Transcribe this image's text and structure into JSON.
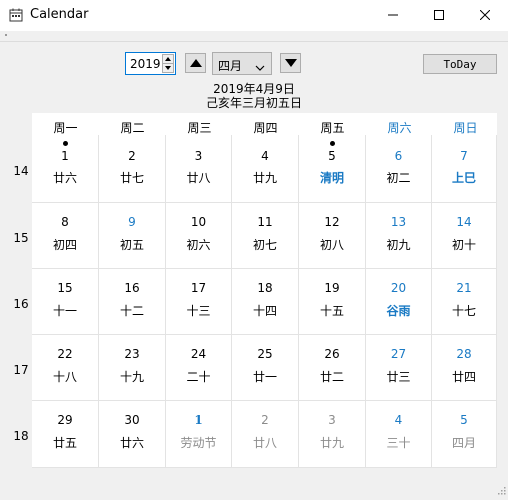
{
  "window": {
    "title": "Calendar"
  },
  "toolbar": {
    "year_value": "2019",
    "month_value": "四月",
    "today_label": "ToDay"
  },
  "date_info": {
    "solar": "2019年4月9日",
    "lunar": "己亥年三月初五日"
  },
  "weekdays": [
    "周一",
    "周二",
    "周三",
    "周四",
    "周五",
    "周六",
    "周日"
  ],
  "week_numbers": [
    "14",
    "15",
    "16",
    "17",
    "18"
  ],
  "weeks": [
    [
      {
        "day": "1",
        "lunar": "廿六",
        "dot": true
      },
      {
        "day": "2",
        "lunar": "廿七"
      },
      {
        "day": "3",
        "lunar": "廿八"
      },
      {
        "day": "4",
        "lunar": "廿九"
      },
      {
        "day": "5",
        "lunar": "清明",
        "dot": true,
        "festival": true
      },
      {
        "day": "6",
        "lunar": "初二",
        "weekend": true
      },
      {
        "day": "7",
        "lunar": "上巳",
        "weekend": true,
        "festival": true
      }
    ],
    [
      {
        "day": "8",
        "lunar": "初四"
      },
      {
        "day": "9",
        "lunar": "初五",
        "weekend": true
      },
      {
        "day": "10",
        "lunar": "初六"
      },
      {
        "day": "11",
        "lunar": "初七"
      },
      {
        "day": "12",
        "lunar": "初八"
      },
      {
        "day": "13",
        "lunar": "初九",
        "weekend": true
      },
      {
        "day": "14",
        "lunar": "初十",
        "weekend": true
      }
    ],
    [
      {
        "day": "15",
        "lunar": "十一"
      },
      {
        "day": "16",
        "lunar": "十二"
      },
      {
        "day": "17",
        "lunar": "十三"
      },
      {
        "day": "18",
        "lunar": "十四"
      },
      {
        "day": "19",
        "lunar": "十五"
      },
      {
        "day": "20",
        "lunar": "谷雨",
        "weekend": true,
        "festival": true
      },
      {
        "day": "21",
        "lunar": "十七",
        "weekend": true
      }
    ],
    [
      {
        "day": "22",
        "lunar": "十八"
      },
      {
        "day": "23",
        "lunar": "十九"
      },
      {
        "day": "24",
        "lunar": "二十"
      },
      {
        "day": "25",
        "lunar": "廿一"
      },
      {
        "day": "26",
        "lunar": "廿二"
      },
      {
        "day": "27",
        "lunar": "廿三",
        "weekend": true
      },
      {
        "day": "28",
        "lunar": "廿四",
        "weekend": true
      }
    ],
    [
      {
        "day": "29",
        "lunar": "廿五"
      },
      {
        "day": "30",
        "lunar": "廿六"
      },
      {
        "day": "1",
        "lunar": "劳动节",
        "other_month": true,
        "labor": true
      },
      {
        "day": "2",
        "lunar": "廿八",
        "other_month": true
      },
      {
        "day": "3",
        "lunar": "廿九",
        "other_month": true
      },
      {
        "day": "4",
        "lunar": "三十",
        "other_month": true,
        "weekend": true
      },
      {
        "day": "5",
        "lunar": "四月",
        "other_month": true,
        "weekend": true
      }
    ]
  ],
  "colors": {
    "weekend": "#1a7ac4",
    "faded": "#8c8c8c",
    "accent": "#0078d7"
  },
  "icons": [
    "calendar-app-icon",
    "minimize-icon",
    "maximize-icon",
    "close-icon",
    "spin-up-icon",
    "spin-down-icon",
    "triangle-up-icon",
    "chevron-down-icon",
    "triangle-down-icon",
    "resize-grip-icon"
  ]
}
